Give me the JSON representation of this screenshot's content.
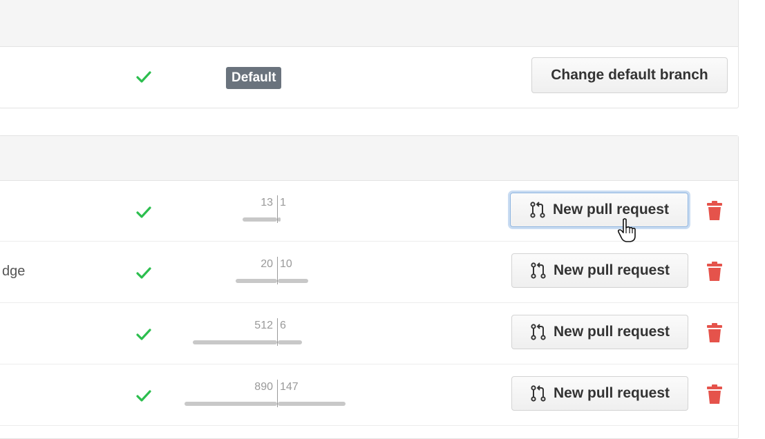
{
  "default_branch": {
    "badge": "Default",
    "change_button": "Change default branch"
  },
  "active_branches": [
    {
      "name_fragment": "",
      "behind": "13",
      "ahead": "1",
      "button": "New pull request"
    },
    {
      "name_fragment": "dge",
      "behind": "20",
      "ahead": "10",
      "button": "New pull request"
    },
    {
      "name_fragment": "",
      "behind": "512",
      "ahead": "6",
      "button": "New pull request"
    },
    {
      "name_fragment": "",
      "behind": "890",
      "ahead": "147",
      "button": "New pull request"
    }
  ],
  "icons": {
    "status": "check-icon",
    "pull_request": "git-pull-request-icon",
    "delete": "trash-icon",
    "cursor": "hand-pointer-icon"
  },
  "colors": {
    "check": "#2cbe4e",
    "trash": "#e5534b",
    "badge_bg": "#6a737d",
    "ahead_behind_bar": "#c8c8c8"
  }
}
